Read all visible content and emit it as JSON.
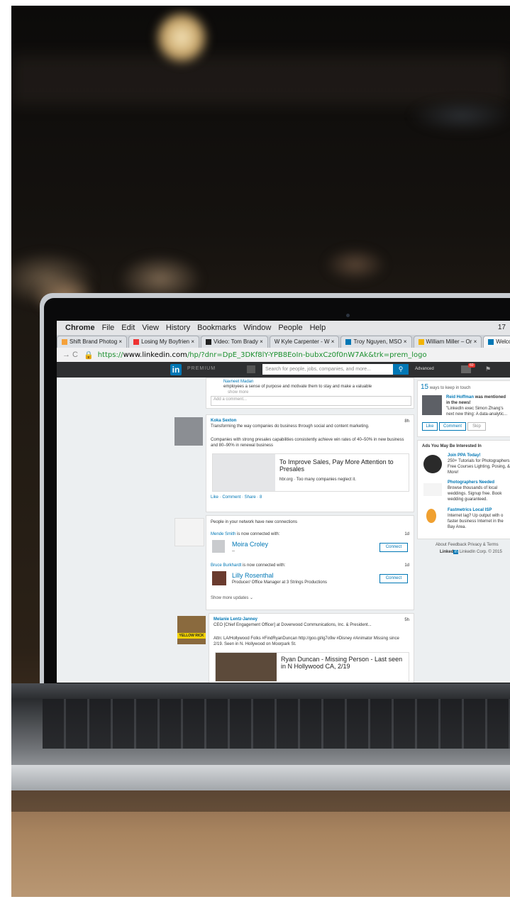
{
  "menubar": {
    "app": "Chrome",
    "items": [
      "File",
      "Edit",
      "View",
      "History",
      "Bookmarks",
      "Window",
      "People",
      "Help"
    ],
    "status": "17"
  },
  "tabs": [
    {
      "label": "Shift Brand Photog ×"
    },
    {
      "label": "Losing My Boyfrien ×"
    },
    {
      "label": "Video: Tom Brady ×"
    },
    {
      "label": "W Kyle Carpenter - W ×"
    },
    {
      "label": "Troy Nguyen, MSO ×"
    },
    {
      "label": "William Miller – Or ×"
    },
    {
      "label": "Welcome! | Li"
    }
  ],
  "address": {
    "scheme": "https://",
    "host": "www.linkedin.com",
    "path": "/hp/?dnr=DpE_3DKf8lY-YPB8EoIn-bubxCz0f0nW7Ak&trk=prem_logo"
  },
  "linkedin": {
    "logo": "in",
    "premium": "PREMIUM",
    "search_placeholder": "Search for people, jobs, companies, and more...",
    "advanced": "Advanced",
    "msg_badge": "60"
  },
  "feed": {
    "top_post": {
      "name": "Navneet Madan",
      "text": "employees a sense of purpose and motivate them to stay and make a valuable",
      "more": "show more",
      "comment_placeholder": "Add a comment..."
    },
    "koka": {
      "name": "Koka Sexton",
      "time": "8h",
      "headline": "Transforming the way companies do business through social and content marketing.",
      "body": "Companies with strong presales capabilities consistently achieve win rates of 40–50% in new business and 80–90% in renewal business",
      "link_title": "To Improve Sales, Pay More Attention to Presales",
      "link_src": "hbr.org · Too many companies neglect it.",
      "actions": "Like · Comment · Share · ",
      "likes": "8"
    },
    "network": {
      "header": "People in your network have new connections",
      "row1_actor": "Mende Smith",
      "row1_verb": "is now connected with:",
      "row1_time": "1d",
      "row1_name": "Moira Croley",
      "row1_sub": "--",
      "row2_actor": "Bruce Burkhardt",
      "row2_verb": "is now connected with:",
      "row2_time": "1d",
      "row2_name": "Lilly Rosenthal",
      "row2_sub": "Producer/ Office Manager at 3 Strings Productions",
      "connect": "Connect",
      "more": "Show more updates ⌄"
    },
    "melanie": {
      "name": "Melanie Lentz-Janney",
      "time": "5h",
      "headline": "CEO [Chief Engagement Officer] at Doverwood Communications, Inc. & President...",
      "body": "Attn: LA/Hollywood Folks #FindRyanDuncan http://goo.gl/ig7o9w #Disney #Animator Missing since 2/19. Seen in N. Hollywood on Moorpark St.",
      "link_title": "Ryan Duncan - Missing Person - Last seen in N Hollywood CA, 2/19",
      "sign": "YELLOW RICK"
    }
  },
  "sidebar": {
    "ways_count": "15",
    "ways_text": "ways to keep in touch",
    "reid": {
      "name": "Reid Hoffman",
      "rest": "was mentioned in the news!",
      "quote": "\"LinkedIn exec Simon Zhang's next new thing: A data-analytic..."
    },
    "actions": [
      "Like",
      "Comment",
      "Skip"
    ],
    "ads_header": "Ads You May Be Interested In",
    "ads": [
      {
        "title": "Join PPA Today!",
        "body": "250+ Tutorials for Photographers! Free Courses Lighting, Posing, & More!"
      },
      {
        "title": "Photographers Needed",
        "body": "Browse thousands of local weddings. Signup free. Book wedding guaranteed."
      },
      {
        "title": "Fastmetrics Local ISP",
        "body": "Internet lag? Up output with o faster business Internet in the Bay Area."
      }
    ],
    "footer_links": "About  Feedback  Privacy & Terms",
    "footer_copy": "LinkedIn Corp. © 2015"
  },
  "colors": {
    "linkedin_blue": "#0077b5",
    "topbar": "#2e2f31"
  }
}
